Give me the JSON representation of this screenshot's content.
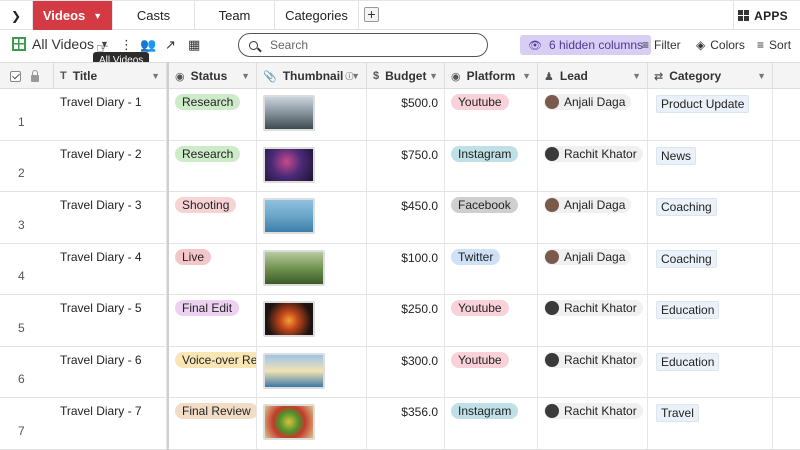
{
  "tabs": [
    {
      "label": "Videos",
      "active": true
    },
    {
      "label": "Casts"
    },
    {
      "label": "Team"
    },
    {
      "label": "Categories"
    }
  ],
  "apps_label": "APPS",
  "toolbar": {
    "view_name": "All Videos",
    "tooltip": "All Videos",
    "search_placeholder": "Search",
    "hidden_columns": "6 hidden columns",
    "filter": "Filter",
    "colors": "Colors",
    "sort": "Sort"
  },
  "columns": {
    "title": "Title",
    "status": "Status",
    "thumbnail": "Thumbnail",
    "budget": "Budget",
    "platform": "Platform",
    "lead": "Lead",
    "category": "Category"
  },
  "rows": [
    {
      "num": "1",
      "title": "Travel Diary - 1",
      "status": "Research",
      "budget": "$500.0",
      "platform": "Youtube",
      "lead": "Anjali Daga",
      "category": "Product Update"
    },
    {
      "num": "2",
      "title": "Travel Diary - 2",
      "status": "Research",
      "budget": "$750.0",
      "platform": "Instagram",
      "lead": "Rachit Khator",
      "category": "News"
    },
    {
      "num": "3",
      "title": "Travel Diary - 3",
      "status": "Shooting",
      "budget": "$450.0",
      "platform": "Facebook",
      "lead": "Anjali Daga",
      "category": "Coaching"
    },
    {
      "num": "4",
      "title": "Travel Diary - 4",
      "status": "Live",
      "budget": "$100.0",
      "platform": "Twitter",
      "lead": "Anjali Daga",
      "category": "Coaching"
    },
    {
      "num": "5",
      "title": "Travel Diary - 5",
      "status": "Final Edit",
      "budget": "$250.0",
      "platform": "Youtube",
      "lead": "Rachit Khator",
      "category": "Education"
    },
    {
      "num": "6",
      "title": "Travel Diary - 6",
      "status": "Voice-over Rec",
      "budget": "$300.0",
      "platform": "Youtube",
      "lead": "Rachit Khator",
      "category": "Education"
    },
    {
      "num": "7",
      "title": "Travel Diary - 7",
      "status": "Final Review",
      "budget": "$356.0",
      "platform": "Instagram",
      "lead": "Rachit Khator",
      "category": "Travel"
    }
  ],
  "colors": {
    "active_tab": "#d33a43",
    "status": {
      "Research": "#cdebc9",
      "Shooting": "#f8d3d6",
      "Live": "#f3c7c9",
      "Final Edit": "#ecd1f1",
      "Voice-over Rec": "#f8e6b5",
      "Final Review": "#f1dcc6"
    },
    "platform": {
      "Youtube": "#f9d1d8",
      "Instagram": "#bfe0e6",
      "Facebook": "#cfcfcf",
      "Twitter": "#cfe1f7"
    }
  }
}
